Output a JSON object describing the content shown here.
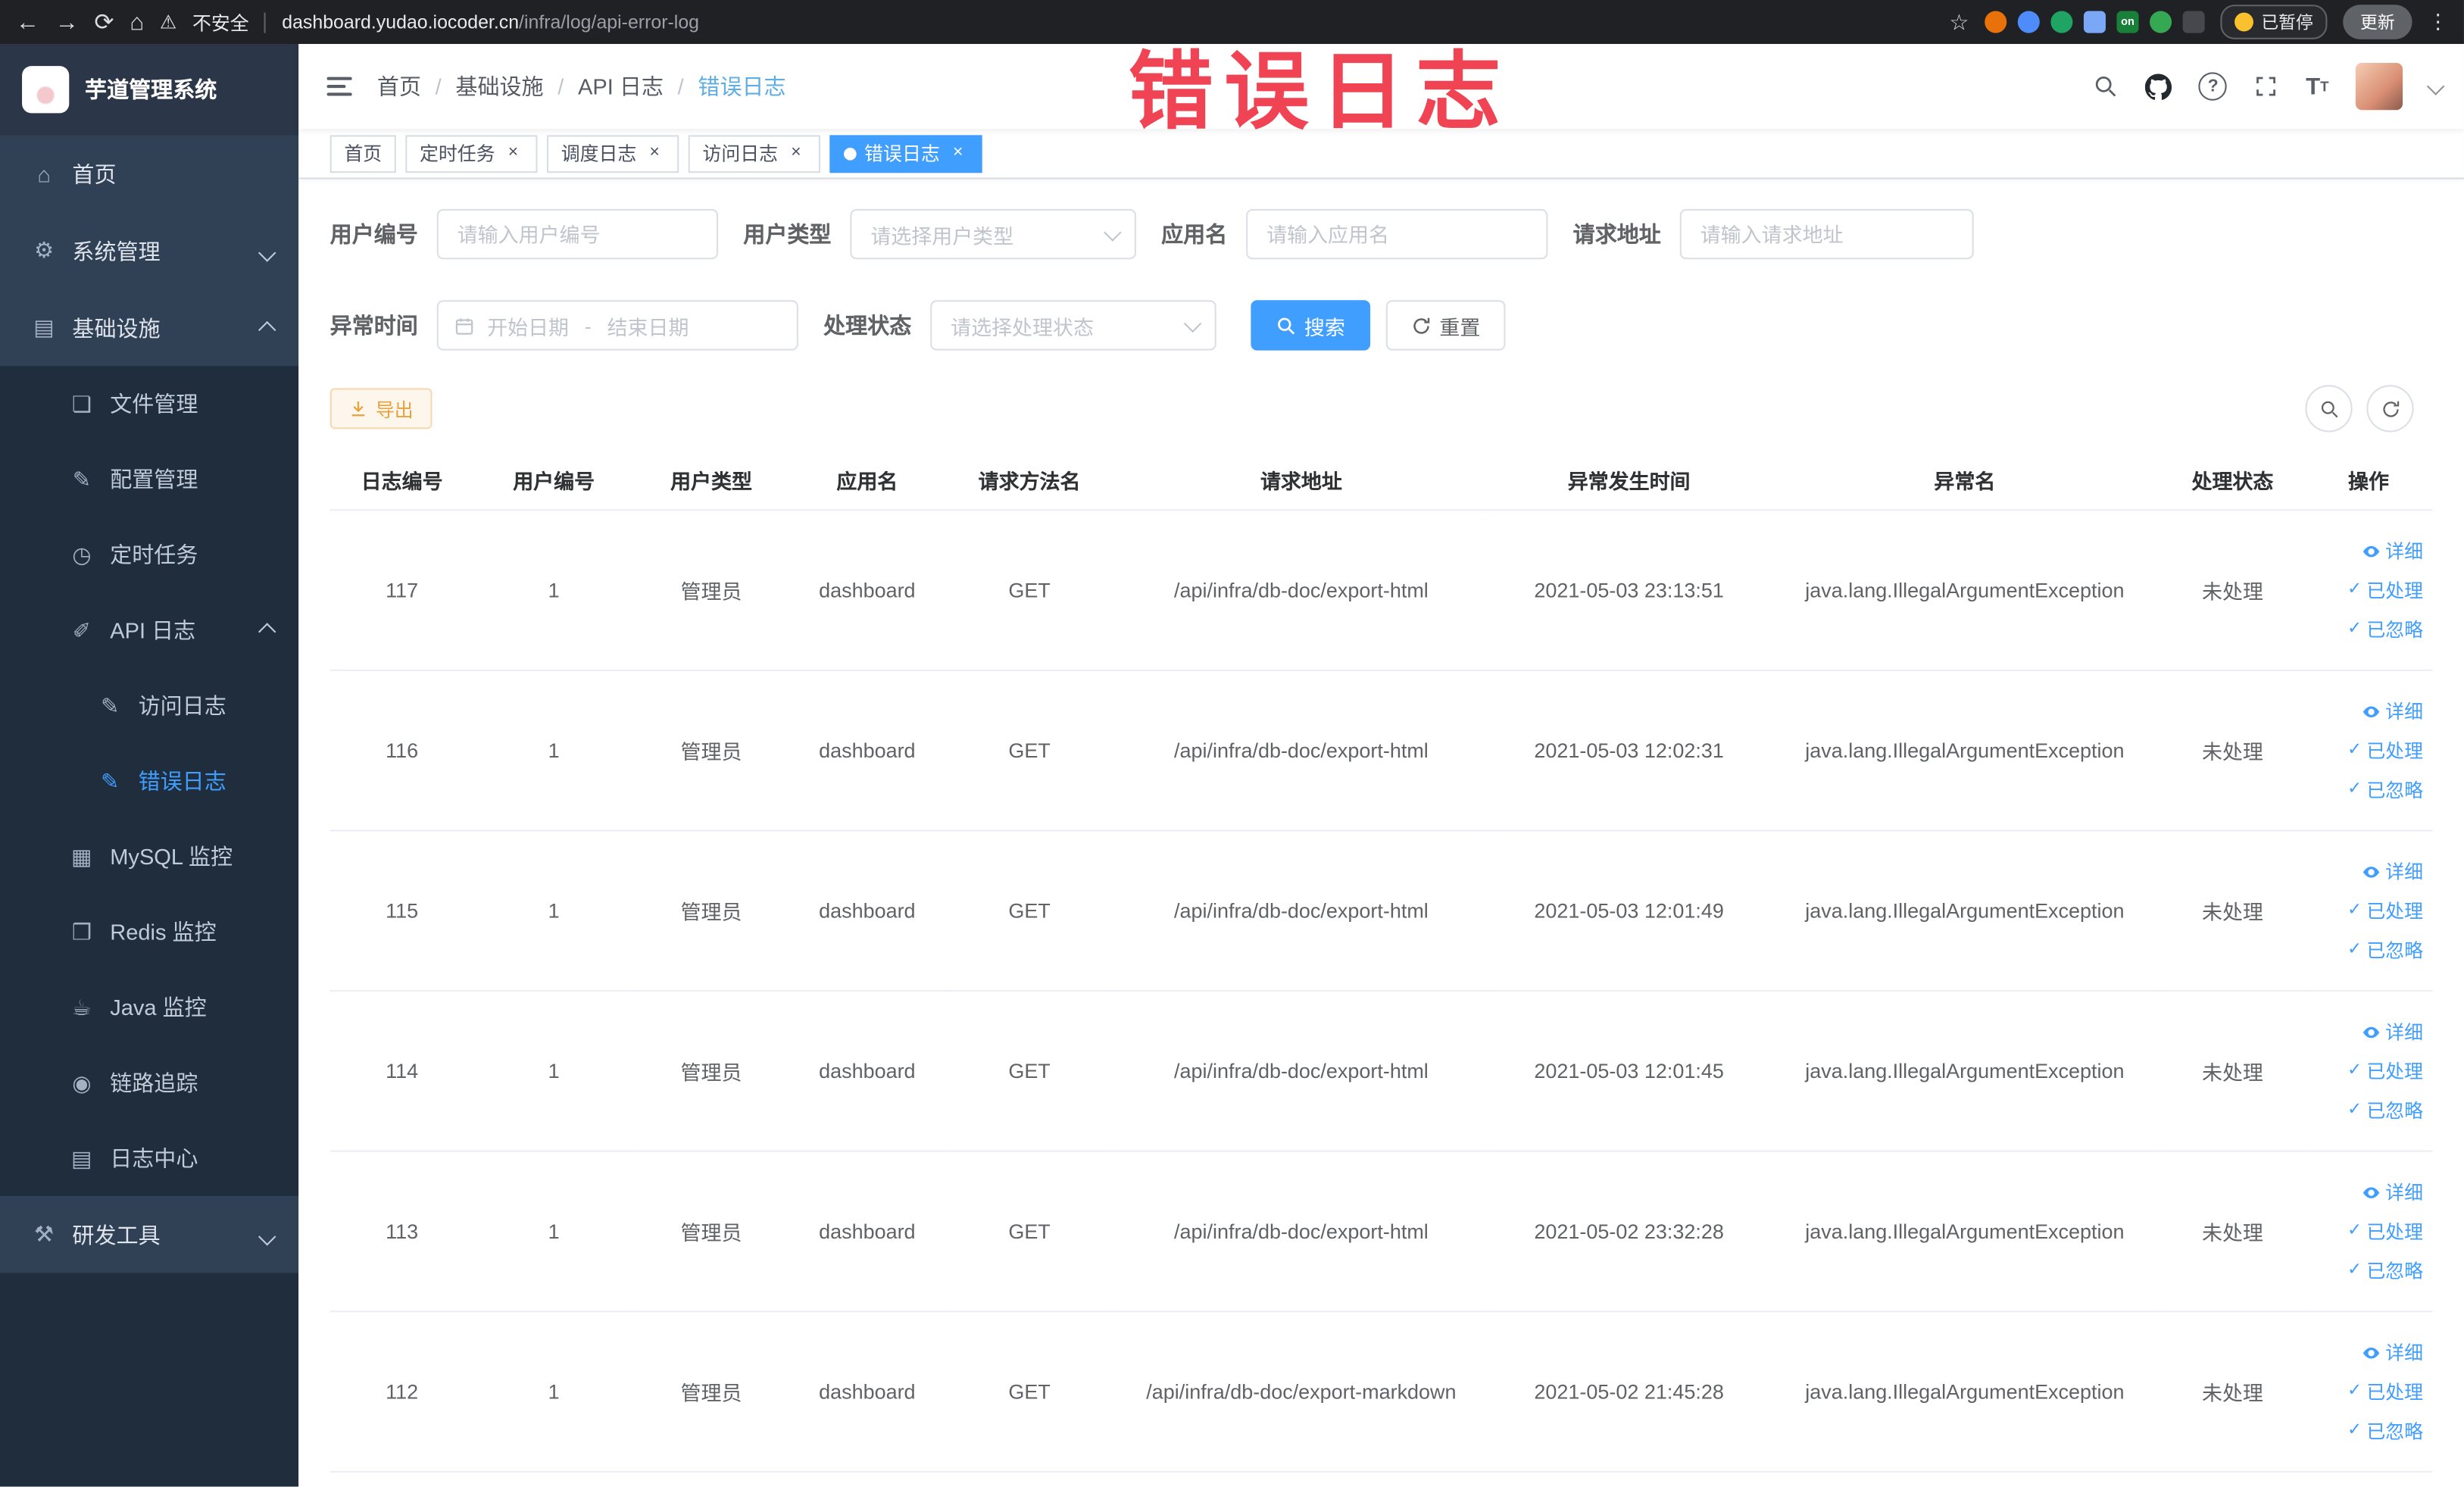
{
  "colors": {
    "accent": "#409eff",
    "annotation_red": "#f04353",
    "warning_orange": "#e6a23c",
    "sidebar_dark": "#1f2d3d",
    "sidebar_light": "#304156",
    "tag_active": "#409eff"
  },
  "annotation": {
    "text": "错误日志"
  },
  "browser": {
    "security_label": "不安全",
    "url_domain": "dashboard.yudao.iocoder.cn",
    "url_path": "/infra/log/api-error-log",
    "paused_label": "已暂停",
    "update_label": "更新",
    "extensions": [
      {
        "name": "orange-extension-icon",
        "color": "#e8710a",
        "shape": "circle",
        "label": ""
      },
      {
        "name": "blue-extension-icon",
        "color": "#4e8cf9",
        "shape": "circle",
        "label": ""
      },
      {
        "name": "teal-extension-icon",
        "color": "#1fa463",
        "shape": "circle",
        "label": ""
      },
      {
        "name": "grid-extension-icon",
        "color": "#7ba7f7",
        "shape": "square",
        "label": ""
      },
      {
        "name": "on-badge-extension-icon",
        "color": "#188038",
        "shape": "square",
        "label": "on"
      },
      {
        "name": "tree-extension-icon",
        "color": "#34a853",
        "shape": "circle",
        "label": ""
      },
      {
        "name": "paw-extension-icon",
        "color": "#46484d",
        "shape": "square",
        "label": ""
      }
    ]
  },
  "sidebar": {
    "logo_title": "芋道管理系统",
    "items": {
      "home": {
        "label": "首页",
        "icon": "⌂"
      },
      "system": {
        "label": "系统管理",
        "icon": "⚙"
      },
      "infra": {
        "label": "基础设施",
        "icon": "▤"
      },
      "file": {
        "label": "文件管理",
        "icon": "❏"
      },
      "config": {
        "label": "配置管理",
        "icon": "✎"
      },
      "job": {
        "label": "定时任务",
        "icon": "◷"
      },
      "api_log": {
        "label": "API 日志",
        "icon": "✐"
      },
      "access_log": {
        "label": "访问日志",
        "icon": "✎"
      },
      "error_log": {
        "label": "错误日志",
        "icon": "✎"
      },
      "mysql": {
        "label": "MySQL 监控",
        "icon": "▦"
      },
      "redis": {
        "label": "Redis 监控",
        "icon": "❒"
      },
      "java": {
        "label": "Java 监控",
        "icon": "☕"
      },
      "trace": {
        "label": "链路追踪",
        "icon": "◉"
      },
      "log_center": {
        "label": "日志中心",
        "icon": "▤"
      },
      "dev": {
        "label": "研发工具",
        "icon": "⚒"
      }
    }
  },
  "header": {
    "breadcrumbs": [
      "首页",
      "基础设施",
      "API 日志",
      "错误日志"
    ]
  },
  "tabs": [
    {
      "label": "首页",
      "closable": false,
      "active": false
    },
    {
      "label": "定时任务",
      "closable": true,
      "active": false
    },
    {
      "label": "调度日志",
      "closable": true,
      "active": false
    },
    {
      "label": "访问日志",
      "closable": true,
      "active": false
    },
    {
      "label": "错误日志",
      "closable": true,
      "active": true
    }
  ],
  "filters": {
    "user_id": {
      "label": "用户编号",
      "placeholder": "请输入用户编号"
    },
    "user_type": {
      "label": "用户类型",
      "placeholder": "请选择用户类型"
    },
    "app_name": {
      "label": "应用名",
      "placeholder": "请输入应用名"
    },
    "request_url": {
      "label": "请求地址",
      "placeholder": "请输入请求地址"
    },
    "exception_time": {
      "label": "异常时间",
      "start_placeholder": "开始日期",
      "separator": "-",
      "end_placeholder": "结束日期"
    },
    "process_status": {
      "label": "处理状态",
      "placeholder": "请选择处理状态"
    },
    "search_label": "搜索",
    "reset_label": "重置"
  },
  "toolbar": {
    "export_label": "导出"
  },
  "table": {
    "columns": [
      "日志编号",
      "用户编号",
      "用户类型",
      "应用名",
      "请求方法名",
      "请求地址",
      "异常发生时间",
      "异常名",
      "处理状态",
      "操作"
    ],
    "actions": [
      "详细",
      "已处理",
      "已忽略"
    ],
    "rows": [
      {
        "id": "117",
        "user_id": "1",
        "user_type": "管理员",
        "app": "dashboard",
        "method": "GET",
        "url": "/api/infra/db-doc/export-html",
        "time": "2021-05-03 23:13:51",
        "exception": "java.lang.IllegalArgumentException",
        "status": "未处理"
      },
      {
        "id": "116",
        "user_id": "1",
        "user_type": "管理员",
        "app": "dashboard",
        "method": "GET",
        "url": "/api/infra/db-doc/export-html",
        "time": "2021-05-03 12:02:31",
        "exception": "java.lang.IllegalArgumentException",
        "status": "未处理"
      },
      {
        "id": "115",
        "user_id": "1",
        "user_type": "管理员",
        "app": "dashboard",
        "method": "GET",
        "url": "/api/infra/db-doc/export-html",
        "time": "2021-05-03 12:01:49",
        "exception": "java.lang.IllegalArgumentException",
        "status": "未处理"
      },
      {
        "id": "114",
        "user_id": "1",
        "user_type": "管理员",
        "app": "dashboard",
        "method": "GET",
        "url": "/api/infra/db-doc/export-html",
        "time": "2021-05-03 12:01:45",
        "exception": "java.lang.IllegalArgumentException",
        "status": "未处理"
      },
      {
        "id": "113",
        "user_id": "1",
        "user_type": "管理员",
        "app": "dashboard",
        "method": "GET",
        "url": "/api/infra/db-doc/export-html",
        "time": "2021-05-02 23:32:28",
        "exception": "java.lang.IllegalArgumentException",
        "status": "未处理"
      },
      {
        "id": "112",
        "user_id": "1",
        "user_type": "管理员",
        "app": "dashboard",
        "method": "GET",
        "url": "/api/infra/db-doc/export-markdown",
        "time": "2021-05-02 21:45:28",
        "exception": "java.lang.IllegalArgumentException",
        "status": "未处理"
      }
    ]
  }
}
